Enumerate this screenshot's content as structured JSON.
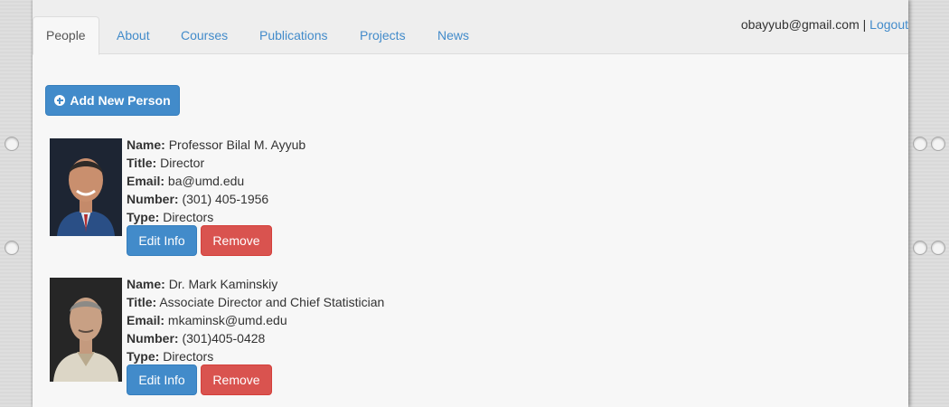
{
  "nav": {
    "tabs": [
      {
        "label": "People"
      },
      {
        "label": "About"
      },
      {
        "label": "Courses"
      },
      {
        "label": "Publications"
      },
      {
        "label": "Projects"
      },
      {
        "label": "News"
      }
    ],
    "active_tab": "People"
  },
  "user": {
    "email": "obayyub@gmail.com",
    "separator": " | ",
    "logout_label": "Logout"
  },
  "actions": {
    "add_person_label": "Add New Person"
  },
  "labels": {
    "name": "Name:",
    "title": "Title:",
    "email": "Email:",
    "number": "Number:",
    "type": "Type:"
  },
  "people": [
    {
      "name": "Professor Bilal M. Ayyub",
      "title": "Director",
      "email": "ba@umd.edu",
      "number": "(301) 405-1956",
      "type": "Directors",
      "edit_label": "Edit Info",
      "remove_label": "Remove"
    },
    {
      "name": "Dr. Mark Kaminskiy",
      "title": "Associate Director and Chief Statistician",
      "email": "mkaminsk@umd.edu",
      "number": "(301)405-0428",
      "type": "Directors",
      "edit_label": "Edit Info",
      "remove_label": "Remove"
    }
  ],
  "colors": {
    "primary": "#428bca",
    "danger": "#d9534f",
    "link": "#428bca",
    "background": "#f7f7f7"
  },
  "icons": {
    "add_button": "plus-circle-icon"
  }
}
